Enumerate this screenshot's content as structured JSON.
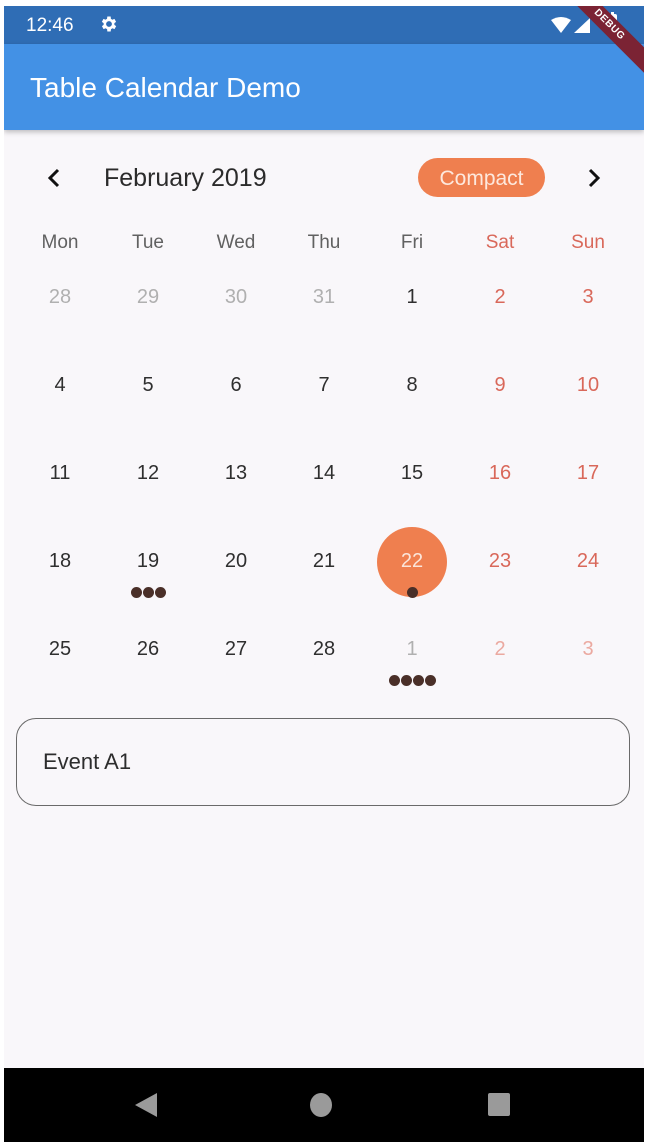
{
  "status_bar": {
    "time": "12:46",
    "icons": [
      "gear-icon",
      "wifi-icon",
      "signal-icon",
      "battery-icon"
    ]
  },
  "app_bar": {
    "title": "Table Calendar Demo",
    "debug_banner": "DEBUG",
    "color": "#4391e5"
  },
  "calendar": {
    "month_title": "February 2019",
    "format_button_label": "Compact",
    "prev_icon": "chevron-left-icon",
    "next_icon": "chevron-right-icon",
    "accent_color": "#ef7f4f",
    "weekend_color": "#d9685a",
    "weekdays": [
      {
        "label": "Mon",
        "weekend": false
      },
      {
        "label": "Tue",
        "weekend": false
      },
      {
        "label": "Wed",
        "weekend": false
      },
      {
        "label": "Thu",
        "weekend": false
      },
      {
        "label": "Fri",
        "weekend": false
      },
      {
        "label": "Sat",
        "weekend": true
      },
      {
        "label": "Sun",
        "weekend": true
      }
    ],
    "weeks": [
      [
        {
          "day": "28",
          "outside": true,
          "events": 0
        },
        {
          "day": "29",
          "outside": true,
          "events": 0
        },
        {
          "day": "30",
          "outside": true,
          "events": 0
        },
        {
          "day": "31",
          "outside": true,
          "events": 0
        },
        {
          "day": "1",
          "outside": false,
          "events": 0
        },
        {
          "day": "2",
          "outside": false,
          "events": 0
        },
        {
          "day": "3",
          "outside": false,
          "events": 0
        }
      ],
      [
        {
          "day": "4",
          "outside": false,
          "events": 0
        },
        {
          "day": "5",
          "outside": false,
          "events": 0
        },
        {
          "day": "6",
          "outside": false,
          "events": 0
        },
        {
          "day": "7",
          "outside": false,
          "events": 0
        },
        {
          "day": "8",
          "outside": false,
          "events": 0
        },
        {
          "day": "9",
          "outside": false,
          "events": 0
        },
        {
          "day": "10",
          "outside": false,
          "events": 0
        }
      ],
      [
        {
          "day": "11",
          "outside": false,
          "events": 0
        },
        {
          "day": "12",
          "outside": false,
          "events": 0
        },
        {
          "day": "13",
          "outside": false,
          "events": 0
        },
        {
          "day": "14",
          "outside": false,
          "events": 0
        },
        {
          "day": "15",
          "outside": false,
          "events": 0
        },
        {
          "day": "16",
          "outside": false,
          "events": 0
        },
        {
          "day": "17",
          "outside": false,
          "events": 0
        }
      ],
      [
        {
          "day": "18",
          "outside": false,
          "events": 0
        },
        {
          "day": "19",
          "outside": false,
          "events": 3
        },
        {
          "day": "20",
          "outside": false,
          "events": 0
        },
        {
          "day": "21",
          "outside": false,
          "events": 0
        },
        {
          "day": "22",
          "outside": false,
          "events": 1,
          "selected": true
        },
        {
          "day": "23",
          "outside": false,
          "events": 0
        },
        {
          "day": "24",
          "outside": false,
          "events": 0
        }
      ],
      [
        {
          "day": "25",
          "outside": false,
          "events": 0
        },
        {
          "day": "26",
          "outside": false,
          "events": 0
        },
        {
          "day": "27",
          "outside": false,
          "events": 0
        },
        {
          "day": "28",
          "outside": false,
          "events": 0
        },
        {
          "day": "1",
          "outside": true,
          "events": 4
        },
        {
          "day": "2",
          "outside": true,
          "events": 0
        },
        {
          "day": "3",
          "outside": true,
          "events": 0
        }
      ]
    ]
  },
  "events": [
    {
      "label": "Event A1"
    }
  ],
  "nav_bar": {
    "buttons": [
      "back-icon",
      "home-icon",
      "recents-icon"
    ]
  }
}
